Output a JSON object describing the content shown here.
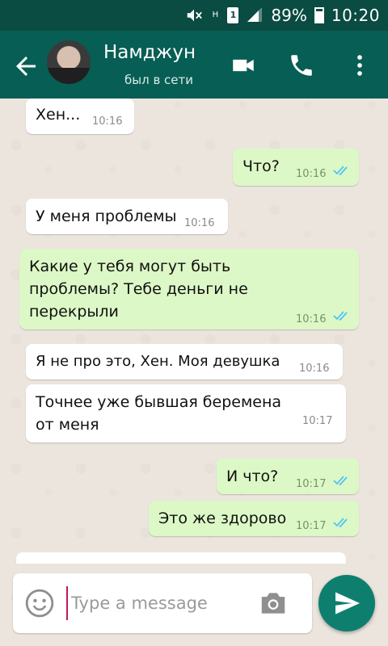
{
  "status_bar": {
    "battery": "89%",
    "time": "10:20",
    "network_type": "H",
    "sim": "1"
  },
  "header": {
    "contact_name": "Намджун",
    "contact_status": "был в сети"
  },
  "messages": [
    {
      "direction": "in",
      "text": "Хен...",
      "time": "10:16"
    },
    {
      "direction": "out",
      "text": "Что?",
      "time": "10:16",
      "read": true
    },
    {
      "direction": "in",
      "text": "У меня проблемы",
      "time": "10:16"
    },
    {
      "direction": "out",
      "text": "Какие у тебя могут быть проблемы? Тебе деньги не перекрыли",
      "lines": [
        "Какие у тебя могут быть",
        "проблемы? Тебе деньги не",
        "перекрыли"
      ],
      "time": "10:16",
      "read": true
    },
    {
      "direction": "in",
      "text": "Я не про это, Хен. Моя девушка",
      "time": "10:16"
    },
    {
      "direction": "in",
      "text": "Точнее уже бывшая беремена от меня",
      "lines": [
        "Точнее уже бывшая беремена",
        "от меня"
      ],
      "time": "10:17"
    },
    {
      "direction": "out",
      "text": "И что?",
      "time": "10:17",
      "read": true
    },
    {
      "direction": "out",
      "text": "Это же здорово",
      "time": "10:17",
      "read": true
    }
  ],
  "composer": {
    "placeholder": "Type a message"
  },
  "colors": {
    "header": "#075e54",
    "status_bar": "#0a4b42",
    "outgoing_bubble": "#dcf8c6",
    "incoming_bubble": "#ffffff",
    "read_ticks": "#4fc3f7",
    "send_button": "#0e7f6f"
  },
  "icons": [
    "mute-icon",
    "signal-icon",
    "battery-icon",
    "back-arrow-icon",
    "video-call-icon",
    "phone-icon",
    "more-vert-icon",
    "emoji-icon",
    "camera-icon",
    "send-icon",
    "double-check-icon"
  ]
}
